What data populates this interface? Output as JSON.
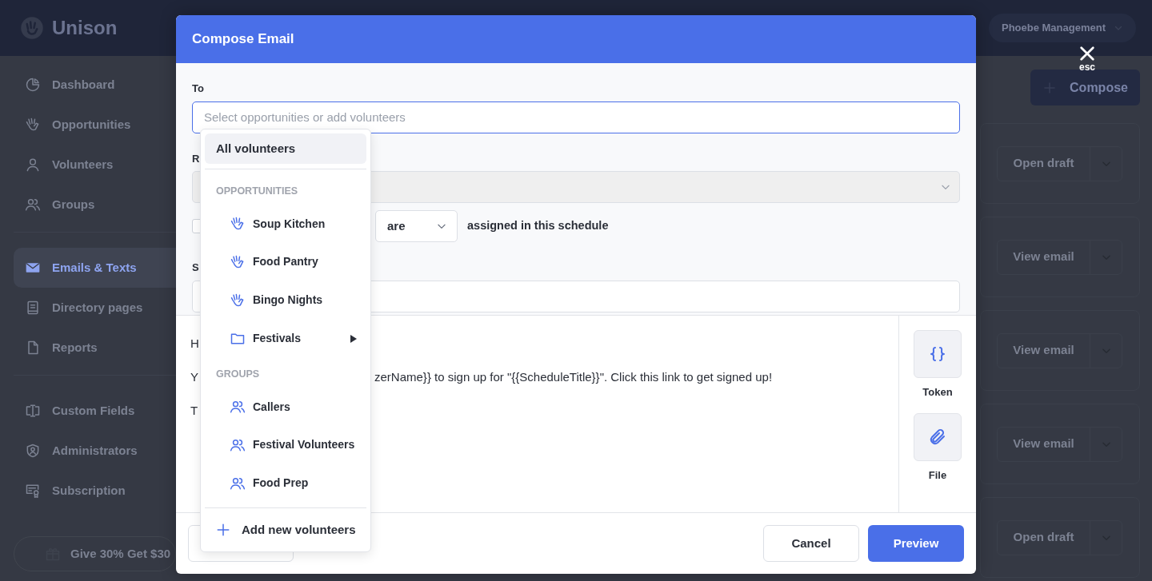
{
  "app": {
    "logo": "Unison",
    "account": "Phoebe Management",
    "compose_button": "Compose",
    "sidebar": [
      [
        {
          "label": "Dashboard",
          "selected": false
        },
        {
          "label": "Opportunities",
          "selected": false
        },
        {
          "label": "Volunteers",
          "selected": false
        },
        {
          "label": "Groups",
          "selected": false
        }
      ],
      [
        {
          "label": "Emails & Texts",
          "selected": true
        },
        {
          "label": "Directory pages",
          "selected": false
        },
        {
          "label": "Reports",
          "selected": false
        }
      ],
      [
        {
          "label": "Custom Fields",
          "selected": false
        },
        {
          "label": "Administrators",
          "selected": false
        },
        {
          "label": "Subscription",
          "selected": false
        }
      ]
    ],
    "promo": "Give 30% Get $30",
    "email_rows": [
      {
        "action": "Open draft"
      },
      {
        "action": "View email"
      },
      {
        "action": "View email"
      },
      {
        "action": "View email"
      },
      {
        "action": "Open draft"
      }
    ]
  },
  "modal": {
    "title": "Compose Email",
    "close_hint": "esc",
    "to": {
      "label": "To",
      "placeholder": "Select opportunities or add volunteers"
    },
    "reply": {
      "label": "R",
      "disabled": true
    },
    "filter": {
      "checked": false,
      "value": "are",
      "text": "assigned in this schedule"
    },
    "subject": {
      "label": "S"
    },
    "body_lines": [
      {
        "text": "H"
      },
      {
        "text": "Y",
        "tail": "zerName}} to sign up for \"{{ScheduleTitle}}\". Click this link to get signed up!"
      },
      {
        "text": "T"
      }
    ],
    "tools": [
      {
        "label": "Token",
        "kind": "token"
      },
      {
        "label": "File",
        "kind": "file"
      }
    ],
    "cancel": "Cancel",
    "preview": "Preview",
    "dropdown": {
      "all": {
        "label": "All volunteers",
        "selected": true
      },
      "sections": [
        {
          "heading": "OPPORTUNITIES",
          "items": [
            {
              "label": "Soup Kitchen",
              "kind": "opportunity"
            },
            {
              "label": "Food Pantry",
              "kind": "opportunity"
            },
            {
              "label": "Bingo Nights",
              "kind": "opportunity"
            },
            {
              "label": "Festivals",
              "kind": "folder"
            }
          ]
        },
        {
          "heading": "GROUPS",
          "items": [
            {
              "label": "Callers",
              "kind": "group"
            },
            {
              "label": "Festival Volunteers",
              "kind": "group"
            },
            {
              "label": "Food Prep",
              "kind": "group"
            }
          ]
        }
      ],
      "add": "Add new volunteers"
    }
  }
}
